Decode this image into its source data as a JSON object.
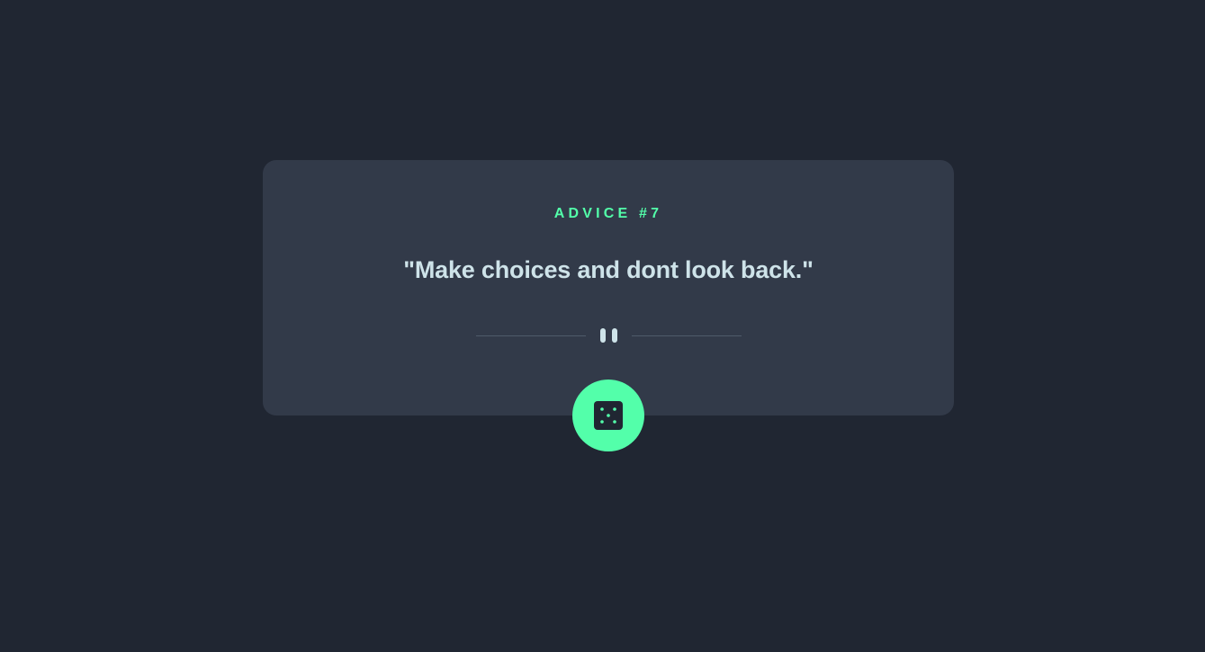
{
  "card": {
    "advice_label": "ADVICE #7",
    "quote": "\"Make choices and dont look back.\""
  },
  "divider": {
    "icon": "pause-icon"
  },
  "button": {
    "icon": "dice-icon",
    "aria_label": "Get new advice"
  },
  "colors": {
    "background": "#202632",
    "card": "#323a49",
    "accent": "#53ffaa",
    "text": "#cee3e9",
    "divider": "#4f5b6a"
  }
}
